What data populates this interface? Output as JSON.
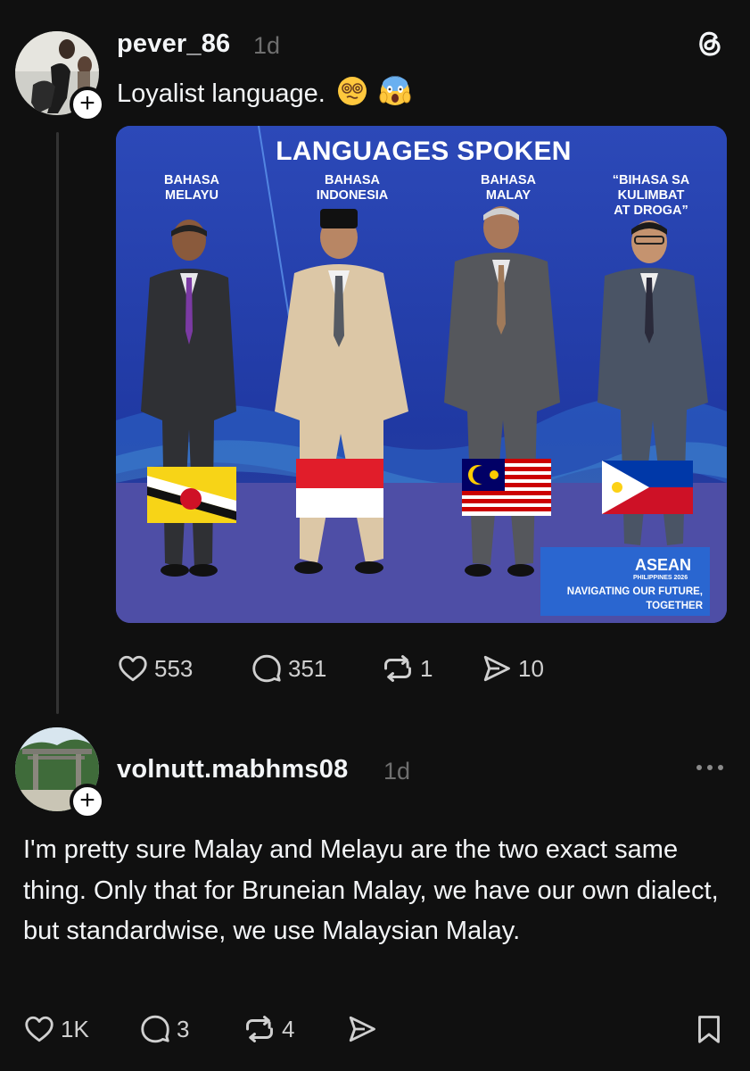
{
  "post": {
    "username": "pever_86",
    "time": "1d",
    "text": "Loyalist language.",
    "emojis": [
      "dizzy-face-emoji",
      "screaming-face-emoji"
    ],
    "app_icon": "threads-logo-icon",
    "media": {
      "title": "LANGUAGES SPOKEN",
      "labels": [
        "BAHASA\nMELAYU",
        "BAHASA\nINDONESIA",
        "BAHASA\nMALAY",
        "“BIHASA SA\nKULIMBAT\nAT DROGA”"
      ],
      "flags": [
        "brunei-flag",
        "indonesia-flag",
        "malaysia-flag",
        "philippines-flag"
      ],
      "logo_name": "ASEAN",
      "logo_sub": "PHILIPPINES 2026",
      "tagline": "NAVIGATING OUR FUTURE,\nTOGETHER"
    },
    "actions": {
      "likes": "553",
      "comments": "351",
      "reposts": "1",
      "shares": "10"
    }
  },
  "reply": {
    "username": "volnutt.mabhms08",
    "time": "1d",
    "text": "I'm pretty sure Malay and Melayu are the two exact same thing. Only that for Bruneian Malay, we have our own dialect, but standardwise, we use Malaysian Malay.",
    "actions": {
      "likes": "1K",
      "comments": "3",
      "reposts": "4"
    }
  },
  "colors": {
    "background": "#101010",
    "text": "#f3f5f7",
    "muted": "#6f6f6f",
    "thread_line": "#333333"
  }
}
